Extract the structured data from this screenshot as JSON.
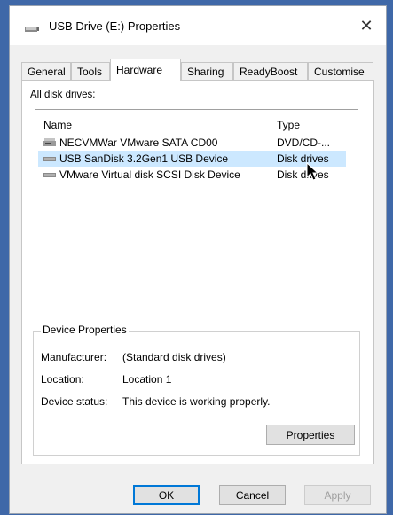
{
  "window": {
    "title": "USB Drive (E:) Properties",
    "close_glyph": "✕",
    "title_icon": "usb-drive-icon"
  },
  "tabs": [
    {
      "label": "General",
      "active": false
    },
    {
      "label": "Tools",
      "active": false
    },
    {
      "label": "Hardware",
      "active": true
    },
    {
      "label": "Sharing",
      "active": false
    },
    {
      "label": "ReadyBoost",
      "active": false
    },
    {
      "label": "Customise",
      "active": false
    }
  ],
  "hardware": {
    "all_disk_drives_label": "All disk drives:",
    "columns": {
      "name": "Name",
      "type": "Type"
    },
    "drives": [
      {
        "name": "NECVMWar VMware SATA CD00",
        "type": "DVD/CD-...",
        "icon": "optical-drive-icon",
        "selected": false
      },
      {
        "name": "USB  SanDisk 3.2Gen1 USB Device",
        "type": "Disk drives",
        "icon": "disk-drive-icon",
        "selected": true
      },
      {
        "name": "VMware Virtual disk SCSI Disk Device",
        "type": "Disk drives",
        "icon": "disk-drive-icon",
        "selected": false
      }
    ],
    "device_properties": {
      "title": "Device Properties",
      "manufacturer_label": "Manufacturer:",
      "manufacturer_value": "(Standard disk drives)",
      "location_label": "Location:",
      "location_value": "Location 1",
      "status_label": "Device status:",
      "status_value": "This device is working properly.",
      "properties_button": "Properties"
    }
  },
  "footer": {
    "ok": "OK",
    "cancel": "Cancel",
    "apply": "Apply"
  },
  "colors": {
    "background": "#3f68a8",
    "selection": "#cce8ff",
    "accent": "#0078d7"
  }
}
